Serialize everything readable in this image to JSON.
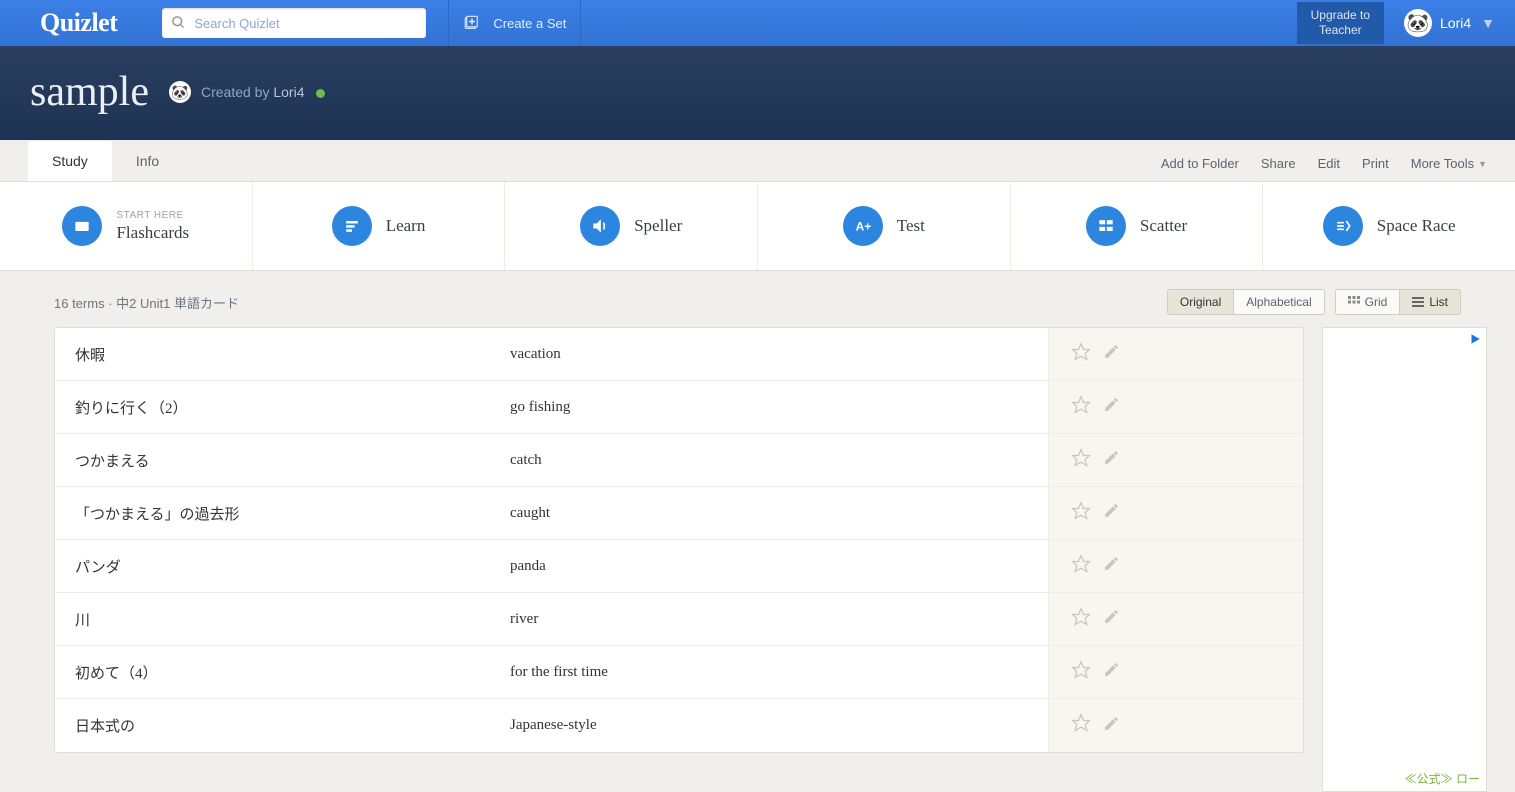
{
  "header": {
    "logo": "Quizlet",
    "search_placeholder": "Search Quizlet",
    "create_set": "Create a Set",
    "upgrade_line1": "Upgrade to",
    "upgrade_line2": "Teacher",
    "username": "Lori4"
  },
  "set": {
    "title": "sample",
    "created_by_prefix": "Created by ",
    "creator": "Lori4"
  },
  "tabs": {
    "study": "Study",
    "info": "Info",
    "actions": {
      "add_to_folder": "Add to Folder",
      "share": "Share",
      "edit": "Edit",
      "print": "Print",
      "more_tools": "More Tools"
    }
  },
  "modes": {
    "start_here": "START HERE",
    "flashcards": "Flashcards",
    "learn": "Learn",
    "speller": "Speller",
    "test": "Test",
    "scatter": "Scatter",
    "space_race": "Space Race"
  },
  "meta": {
    "terms_count": "16 terms",
    "separator": " · ",
    "source": "中2 Unit1 単語カード",
    "original": "Original",
    "alphabetical": "Alphabetical",
    "grid": "Grid",
    "list": "List"
  },
  "terms": [
    {
      "term": "休暇",
      "definition": "vacation"
    },
    {
      "term": "釣りに行く（2）",
      "definition": "go fishing"
    },
    {
      "term": "つかまえる",
      "definition": "catch"
    },
    {
      "term": "「つかまえる」の過去形",
      "definition": "caught"
    },
    {
      "term": "パンダ",
      "definition": "panda"
    },
    {
      "term": "川",
      "definition": "river"
    },
    {
      "term": "初めて（4）",
      "definition": "for the first time"
    },
    {
      "term": "日本式の",
      "definition": "Japanese-style"
    }
  ],
  "ad": {
    "bottom_text": "≪公式≫ ロー"
  }
}
